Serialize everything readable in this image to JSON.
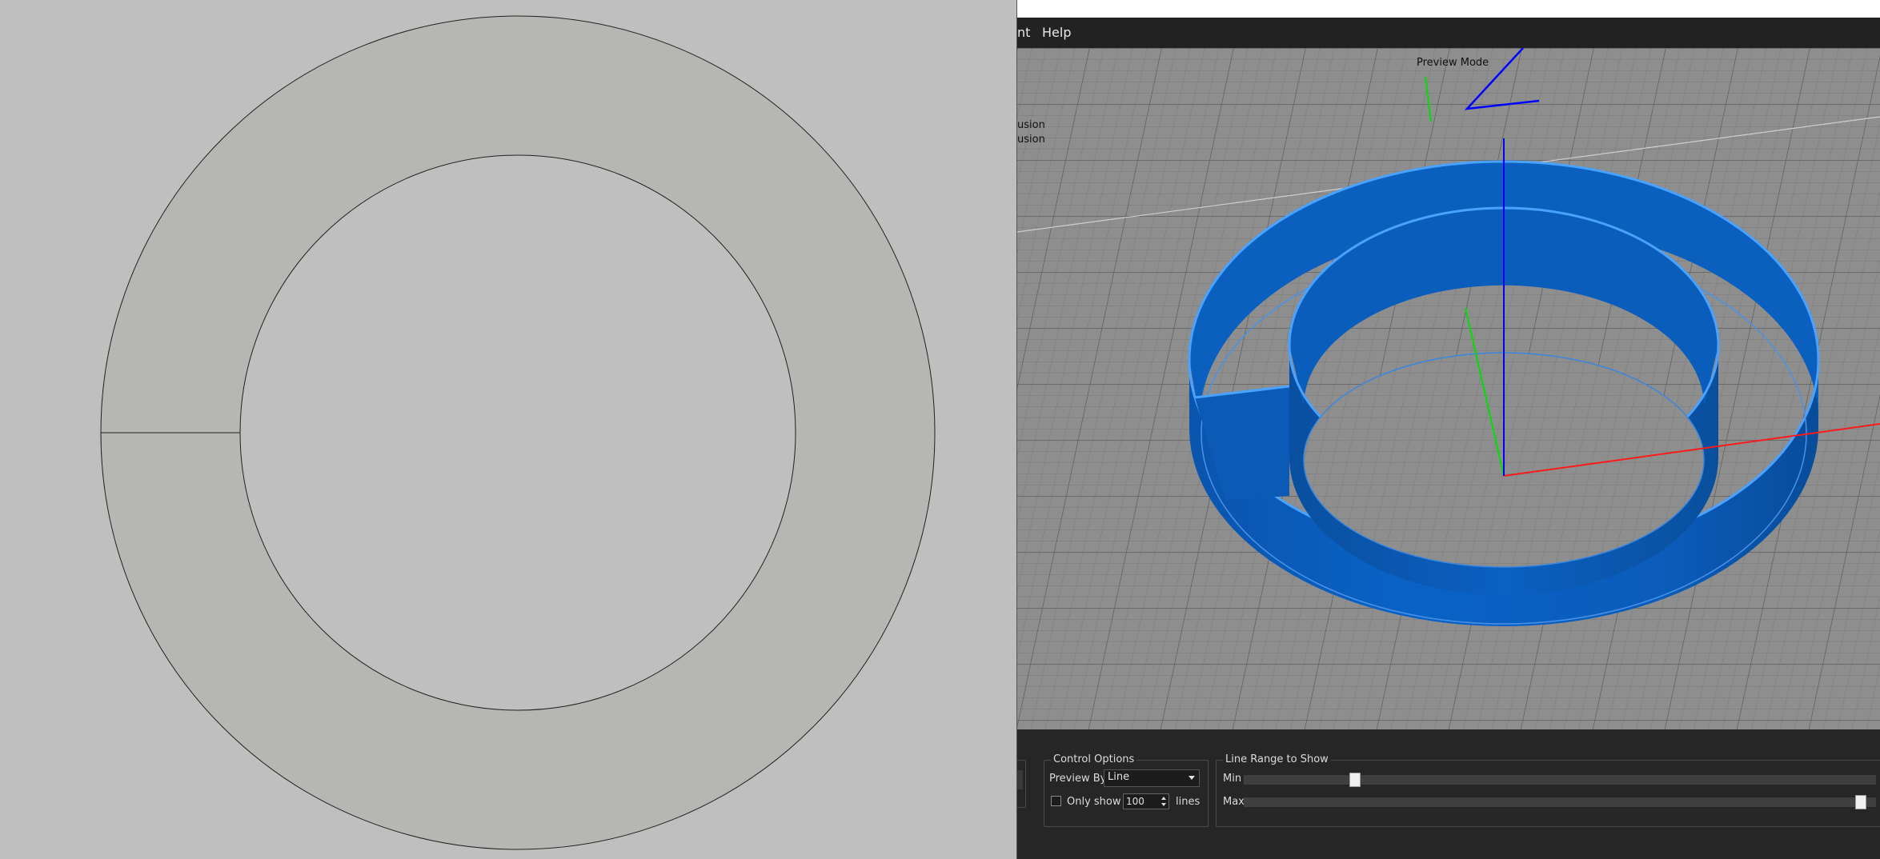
{
  "menubar": {
    "items": [
      "nt",
      "Help"
    ]
  },
  "viewport": {
    "mode_label": "Preview Mode",
    "legend_lines": [
      "usion",
      "usion"
    ],
    "colors": {
      "background": "#8c8c8c",
      "model": "#0a5fc0",
      "x_axis": "#ff0000",
      "y_axis": "#00e000",
      "z_axis": "#0000ff"
    }
  },
  "control_options": {
    "title": "Control Options",
    "preview_by_label": "Preview By",
    "preview_by_value": "Line",
    "only_show_label": "Only show",
    "only_show_value": "100",
    "only_show_checked": false,
    "lines_label": "lines"
  },
  "line_range": {
    "title": "Line Range to Show",
    "min_label": "Min",
    "max_label": "Max",
    "min_fraction": 0.17,
    "max_fraction": 0.985
  }
}
